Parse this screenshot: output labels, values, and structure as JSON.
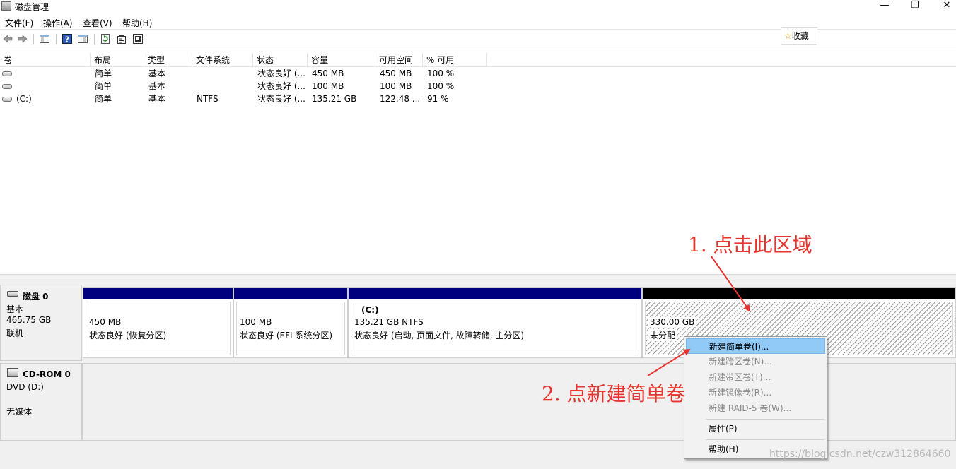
{
  "window": {
    "title": "磁盘管理",
    "minimize_glyph": "—",
    "restore_glyph": "❐",
    "close_glyph": "✕"
  },
  "menu": {
    "file": "文件(F)",
    "action": "操作(A)",
    "view": "查看(V)",
    "help": "帮助(H)"
  },
  "toolbar": {
    "icons": [
      "back-icon",
      "forward-icon",
      "show-hide-console-tree-icon",
      "help-icon",
      "show-hide-action-pane-icon",
      "refresh-icon",
      "properties-icon",
      "disk-settings-icon"
    ]
  },
  "favorites": {
    "label": "收藏"
  },
  "volume_list": {
    "headers": [
      "卷",
      "布局",
      "类型",
      "文件系统",
      "状态",
      "容量",
      "可用空间",
      "% 可用"
    ],
    "rows": [
      {
        "volume": "",
        "layout": "简单",
        "type": "基本",
        "fs": "",
        "status": "状态良好 (...",
        "capacity": "450 MB",
        "free": "450 MB",
        "pct": "100 %"
      },
      {
        "volume": "",
        "layout": "简单",
        "type": "基本",
        "fs": "",
        "status": "状态良好 (...",
        "capacity": "100 MB",
        "free": "100 MB",
        "pct": "100 %"
      },
      {
        "volume": "(C:)",
        "layout": "简单",
        "type": "基本",
        "fs": "NTFS",
        "status": "状态良好 (...",
        "capacity": "135.21 GB",
        "free": "122.48 ...",
        "pct": "91 %"
      }
    ]
  },
  "disk0": {
    "name": "磁盘 0",
    "type": "基本",
    "size": "465.75 GB",
    "state": "联机",
    "partitions": [
      {
        "title": "",
        "size": "450 MB",
        "status": "状态良好 (恢复分区)",
        "bar_color": "#00007f"
      },
      {
        "title": "",
        "size": "100 MB",
        "status": "状态良好 (EFI 系统分区)",
        "bar_color": "#00007f"
      },
      {
        "title": "(C:)",
        "size": "135.21 GB NTFS",
        "status": "状态良好 (启动, 页面文件, 故障转储, 主分区)",
        "bar_color": "#00007f"
      },
      {
        "title": "",
        "size": "330.00 GB",
        "status": "未分配",
        "bar_color": "#000000"
      }
    ]
  },
  "cdrom0": {
    "name": "CD-ROM 0",
    "type": "DVD (D:)",
    "media": "无媒体"
  },
  "context_menu": {
    "items": [
      {
        "label": "新建简单卷(I)...",
        "enabled": true,
        "highlighted": true
      },
      {
        "label": "新建跨区卷(N)...",
        "enabled": false
      },
      {
        "label": "新建带区卷(T)...",
        "enabled": false
      },
      {
        "label": "新建镜像卷(R)...",
        "enabled": false
      },
      {
        "label": "新建 RAID-5 卷(W)...",
        "enabled": false
      },
      {
        "label": "属性(P)",
        "enabled": true
      },
      {
        "label": "帮助(H)",
        "enabled": true
      }
    ]
  },
  "annotations": {
    "step1": "1. 点击此区域",
    "step2": "2. 点新建简单卷",
    "color": "#e8332e"
  },
  "watermark": "https://blog.csdn.net/czw312864660"
}
